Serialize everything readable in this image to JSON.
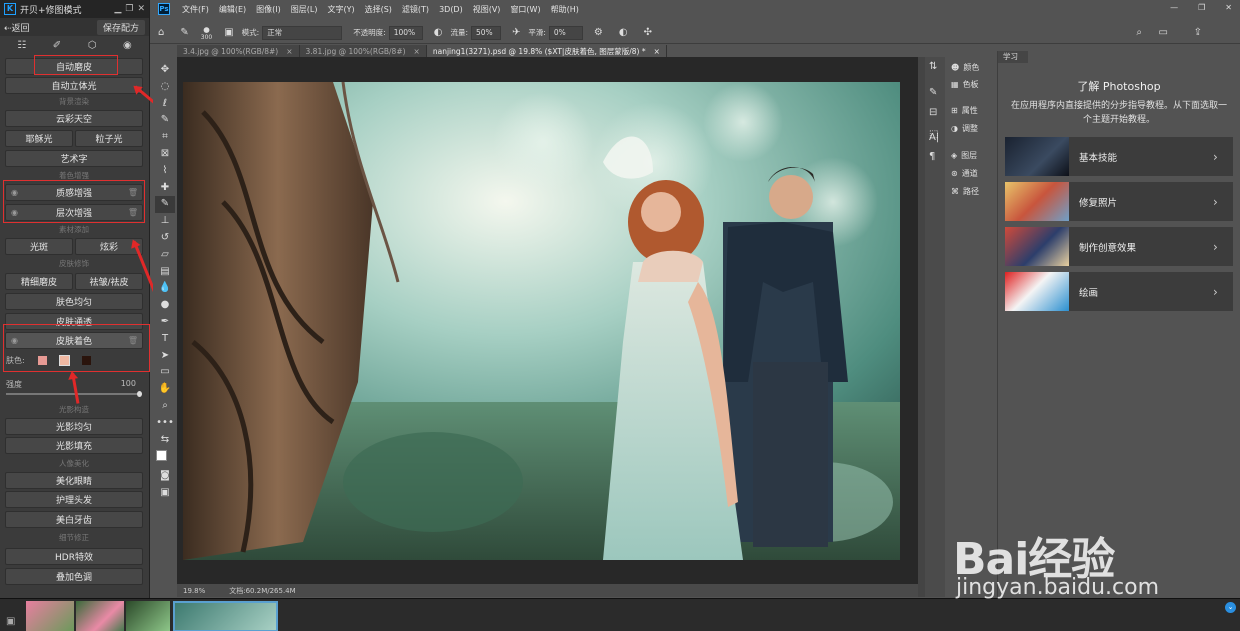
{
  "plugin": {
    "title": "开贝+修图模式",
    "back_label": "返回",
    "save_label": "保存配方",
    "buttons": {
      "auto_skin": "自动磨皮",
      "auto_3d": "自动立体光",
      "sky": "云彩天空",
      "haze": "耶稣光",
      "particle": "粒子光",
      "art_text": "艺术字",
      "texture": "质感增强",
      "layer": "层次增强",
      "spot": "光斑",
      "dazzle": "炫彩",
      "fine_skin": "精细磨皮",
      "wrinkle": "祛皱/祛皮",
      "skin_even": "肤色均匀",
      "skin_clear": "皮肤通透",
      "skin_color": "皮肤着色",
      "light_even": "光影均匀",
      "light_fill": "光影填充",
      "eyes": "美化眼睛",
      "hair": "护理头发",
      "teeth": "美白牙齿",
      "hdr": "HDR特效",
      "overlay": "叠加色调"
    },
    "sections": {
      "bg": "背景渲染",
      "color": "着色增强",
      "material": "素材添加",
      "skin": "皮肤修饰",
      "light": "光影构造",
      "portrait": "人像美化",
      "detail": "细节修正"
    },
    "skin_label": "肤色:",
    "skin_swatches": [
      "#e79a94",
      "#f0b8a2",
      "#2a140c"
    ],
    "strength_label": "强度",
    "strength_value": "100",
    "strength_level": 1.0
  },
  "menubar": {
    "items": [
      "文件(F)",
      "编辑(E)",
      "图像(I)",
      "图层(L)",
      "文字(Y)",
      "选择(S)",
      "滤镜(T)",
      "3D(D)",
      "视图(V)",
      "窗口(W)",
      "帮助(H)"
    ]
  },
  "options": {
    "brush_size": "300",
    "mode_label": "模式:",
    "mode_value": "正常",
    "opacity_label": "不透明度:",
    "opacity_value": "100%",
    "flow_label": "流量:",
    "flow_value": "50%",
    "smooth_label": "平滑:",
    "smooth_value": "0%"
  },
  "tabs": [
    {
      "label": "3.4.jpg @ 100%(RGB/8#)"
    },
    {
      "label": "3.81.jpg @ 100%(RGB/8#)"
    },
    {
      "label": "nanjing1(3271).psd @ 19.8% ($XT|皮肤着色, 图层蒙版/8) *"
    }
  ],
  "status": {
    "zoom": "19.8%",
    "doc": "文档:60.2M/265.4M"
  },
  "panels": {
    "items": [
      "颜色",
      "色板",
      "属性",
      "调整",
      "图层",
      "通道",
      "路径"
    ]
  },
  "learn": {
    "tab": "学习",
    "title": "了解 Photoshop",
    "desc": "在应用程序内直接提供的分步指导教程。从下面选取一个主题开始教程。",
    "cards": [
      "基本技能",
      "修复照片",
      "制作创意效果",
      "绘画"
    ]
  },
  "watermark": {
    "main": "Bai经验",
    "sub": "jingyan.baidu.com"
  }
}
